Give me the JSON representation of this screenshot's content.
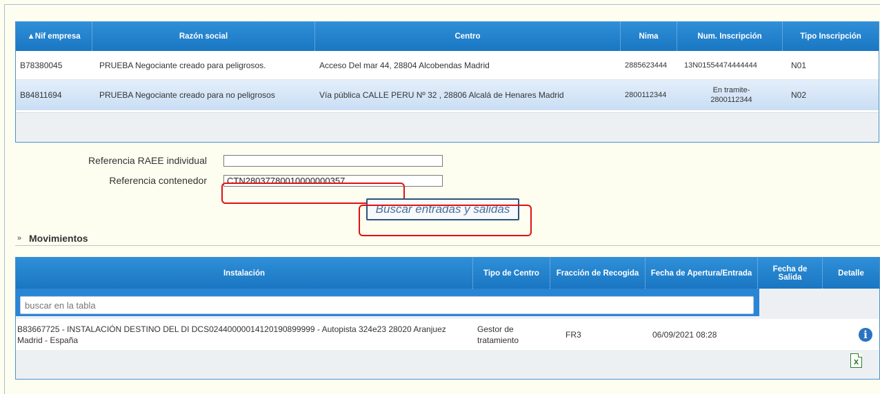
{
  "empresas": {
    "columns": [
      "▲Nif empresa",
      "Razón social",
      "Centro",
      "Nima",
      "Num. Inscripción",
      "Tipo Inscripción"
    ],
    "rows": [
      {
        "nif": "B78380045",
        "razon": "PRUEBA Negociante creado para peligrosos.",
        "centro": "Acceso Del mar 44, 28804 Alcobendas Madrid",
        "nima": "2885623444",
        "num": "13N01554474444444",
        "tipo": "N01"
      },
      {
        "nif": "B84811694",
        "razon": "PRUEBA Negociante creado para no peligrosos",
        "centro": "Vía pública CALLE PERU Nº 32 , 28806 Alcalá de Henares Madrid",
        "nima": "2800112344",
        "num": "En tramite-\n2800112344",
        "tipo": "N02"
      }
    ]
  },
  "form": {
    "ref_raee_label": "Referencia RAEE individual",
    "ref_raee_value": "",
    "ref_contenedor_label": "Referencia contenedor",
    "ref_contenedor_value": "CTN28037780010000000357",
    "search_button": "Buscar entradas y salidas"
  },
  "movimientos": {
    "section_title": "Movimientos",
    "columns": [
      "Instalación",
      "Tipo de Centro",
      "Fracción de Recogida",
      "Fecha de Apertura/Entrada",
      "Fecha de Salida",
      "Detalle"
    ],
    "filter_placeholder": "buscar en la tabla",
    "rows": [
      {
        "instalacion": "B83667725 - INSTALACIÓN DESTINO DEL DI DCS02440000014120190899999 - Autopista 324e23 28020 Aranjuez Madrid - España",
        "tipo_centro": "Gestor de tratamiento",
        "fraccion": "FR3",
        "fecha_entrada": "06/09/2021 08:28",
        "fecha_salida": ""
      }
    ]
  },
  "icons": {
    "info": "info-icon",
    "excel": "excel-export-icon",
    "section": "double-chevron-right-icon"
  },
  "colors": {
    "header_blue": "#1f80cc",
    "highlight": "#e01010",
    "background": "#fdfdf0"
  }
}
